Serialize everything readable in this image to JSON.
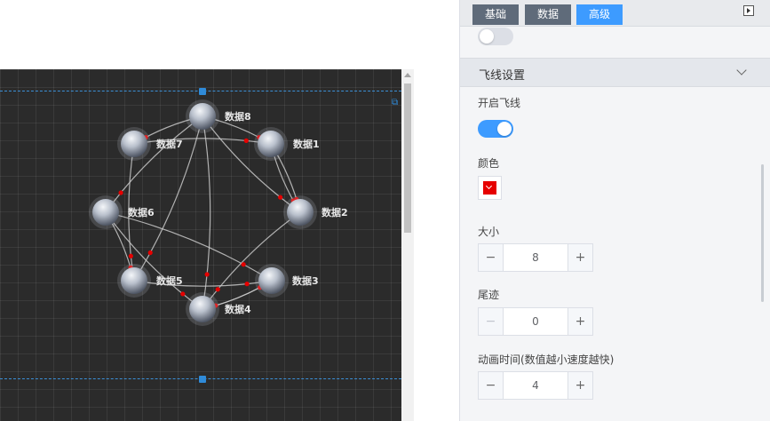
{
  "panel": {
    "tabs": [
      {
        "label": "基础",
        "active": false
      },
      {
        "label": "数据",
        "active": false
      },
      {
        "label": "高级",
        "active": true
      }
    ],
    "top_toggle_on": false,
    "section_title": "飞线设置",
    "fields": {
      "enable_label": "开启飞线",
      "enable_on": true,
      "color_label": "颜色",
      "color_value": "#e60000",
      "size_label": "大小",
      "size_value": "8",
      "trail_label": "尾迹",
      "trail_value": "0",
      "anim_label": "动画时间(数值越小速度越快)",
      "anim_value": "4"
    }
  },
  "stepper": {
    "minus": "−",
    "plus": "+"
  },
  "graph": {
    "nodes": [
      {
        "id": "n8",
        "label": "数据8"
      },
      {
        "id": "n1",
        "label": "数据1"
      },
      {
        "id": "n2",
        "label": "数据2"
      },
      {
        "id": "n3",
        "label": "数据3"
      },
      {
        "id": "n4",
        "label": "数据4"
      },
      {
        "id": "n5",
        "label": "数据5"
      },
      {
        "id": "n6",
        "label": "数据6"
      },
      {
        "id": "n7",
        "label": "数据7"
      }
    ],
    "edges": [
      [
        "n8",
        "n7"
      ],
      [
        "n8",
        "n1"
      ],
      [
        "n8",
        "n6"
      ],
      [
        "n8",
        "n4"
      ],
      [
        "n8",
        "n2"
      ],
      [
        "n8",
        "n5"
      ],
      [
        "n1",
        "n2"
      ],
      [
        "n1",
        "n2b"
      ],
      [
        "n2",
        "n4"
      ],
      [
        "n6",
        "n3"
      ],
      [
        "n6",
        "n4"
      ],
      [
        "n6",
        "n5"
      ],
      [
        "n7",
        "n5"
      ],
      [
        "n7",
        "n1"
      ],
      [
        "n5",
        "n3"
      ],
      [
        "n3",
        "n4"
      ],
      [
        "n4",
        "n3b"
      ]
    ],
    "line_color": "#c9c9c9",
    "arrow_color": "#e60000"
  }
}
